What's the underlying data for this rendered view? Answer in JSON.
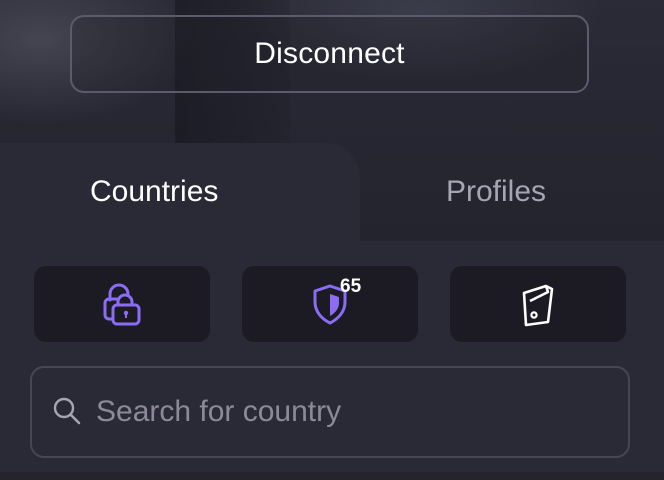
{
  "header": {
    "disconnect_label": "Disconnect"
  },
  "tabs": [
    {
      "label": "Countries",
      "active": true
    },
    {
      "label": "Profiles",
      "active": false
    }
  ],
  "filters": [
    {
      "icon": "lock-icon",
      "color": "#8b6cf5"
    },
    {
      "icon": "shield-icon",
      "color": "#8b6cf5",
      "badge": "65"
    },
    {
      "icon": "server-icon",
      "color": "#ffffff"
    }
  ],
  "search": {
    "placeholder": "Search for country",
    "value": ""
  },
  "colors": {
    "accent": "#8b6cf5",
    "background": "#1c1b22",
    "panel": "#2a2936"
  }
}
